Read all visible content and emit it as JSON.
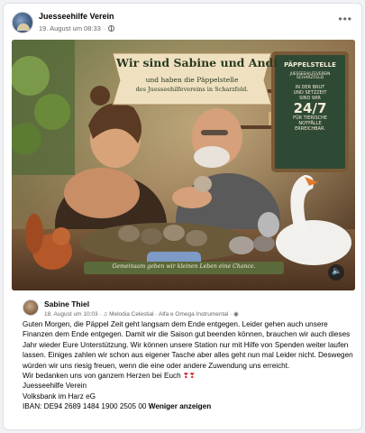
{
  "post": {
    "page_name": "Juesseehilfe Verein",
    "timestamp": "19. August um 08:33",
    "separator": "·",
    "more_label": "•••"
  },
  "image": {
    "headline": "Wir sind Sabine und Andi",
    "subline1": "und haben die Päppelstelle",
    "subline2": "des Juesseehilfevereins in Scharzfeld.",
    "board_title": "PÄPPELSTELLE",
    "board_line1": "JUESSEEHILFEVEREIN",
    "board_line2": "SCHARZFELD",
    "board_line3": "IN DER BRUT",
    "board_line4": "UND SETZZEIT",
    "board_line5": "SIND WIR",
    "board_big": "24/7",
    "board_line6": "FÜR TIERISCHE",
    "board_line7": "NOTFÄLLE",
    "board_line8": "ERREICHBAR.",
    "banner": "Gemeinsam geben wir kleinen Leben eine Chance.",
    "volume_icon": "speaker-icon"
  },
  "comment": {
    "author": "Sabine Thiel",
    "meta": "18. August um 10:03 · ♫ Melodia Celestial · Alfa e Omega Instrumental · ◉",
    "lines": [
      "Guten Morgen, die Päppel Zeit geht langsam dem Ende entgegen. Leider gehen auch unsere Finanzen dem Ende entgegen. Damit wir die Saison gut beenden können, brauchen wir auch dieses Jahr wieder Eure Unterstützung. Wir können unsere Station nur mit Hilfe von Spenden weiter laufen lassen. Einiges zahlen wir schon aus eigener Tasche aber alles geht nun mal Leider nicht. Deswegen würden wir uns riesig freuen, wenn die eine oder andere Zuwendung uns erreicht.",
      "Wir bedanken uns von ganzem Herzen bei Euch",
      "Juesseehilfe Verein",
      "Volksbank im Harz eG",
      "IBAN: DE94 2689 1484 1900 2505 00"
    ],
    "hearts": "❣❣",
    "show_less": "Weniger anzeigen"
  },
  "colors": {
    "banner_green": "#5a6a3a",
    "board_green": "#2f4a34",
    "chalk": "#f3ead6",
    "meta_gray": "#65676b"
  }
}
